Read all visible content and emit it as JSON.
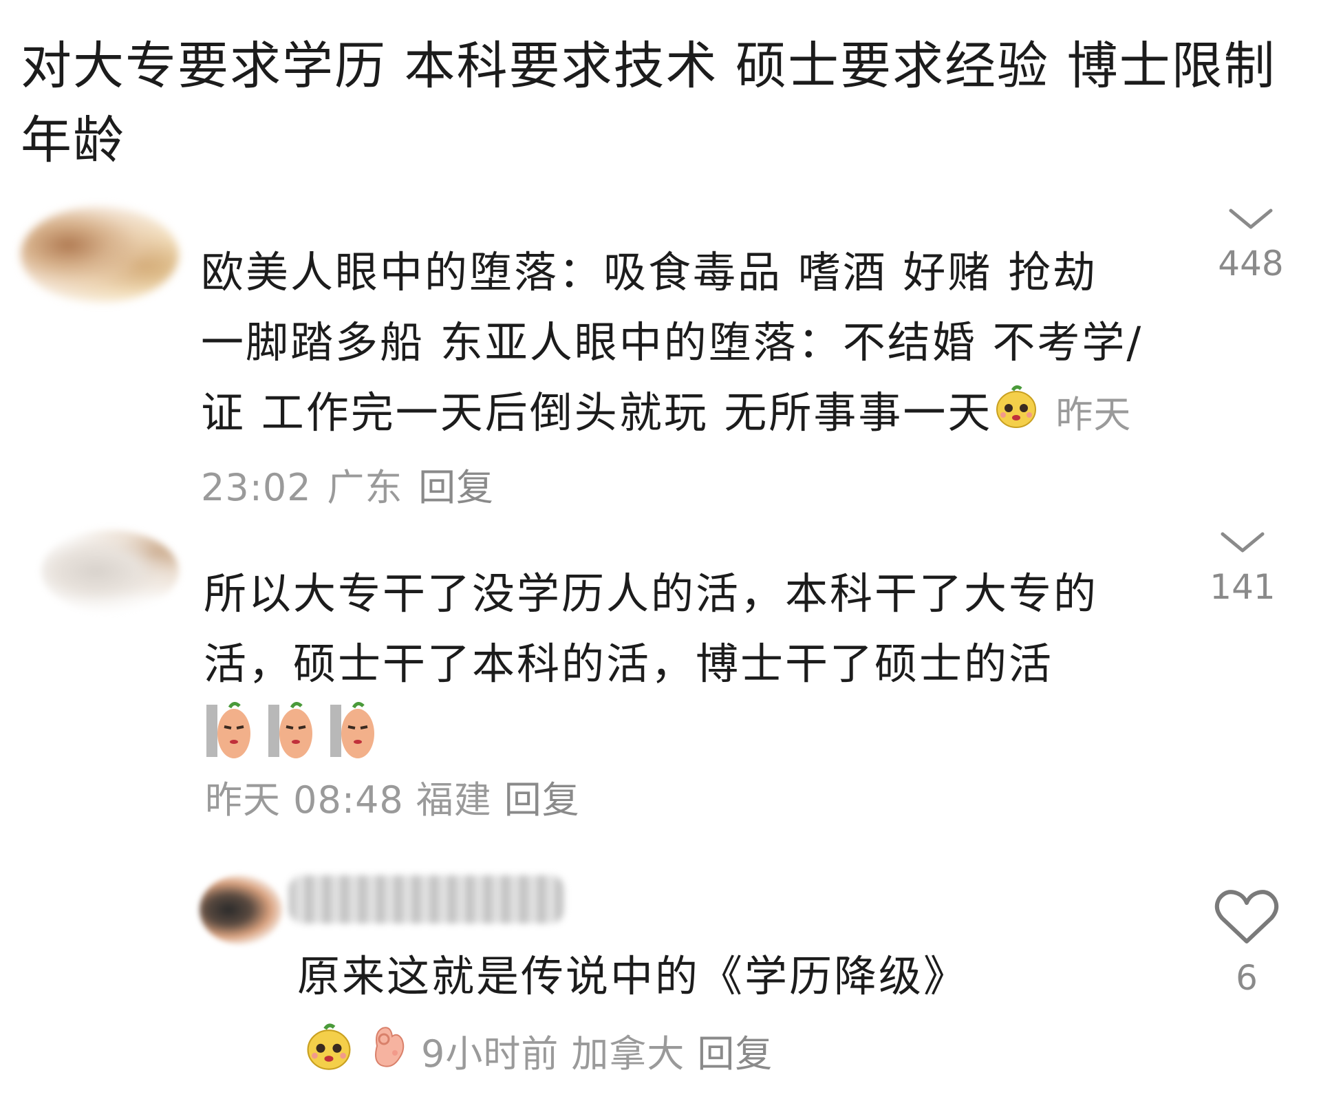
{
  "post": {
    "title": "对大专要求学历  本科要求技术  硕士要求经验 博士限制年龄"
  },
  "comments": [
    {
      "text": "欧美人眼中的堕落：吸食毒品 嗜酒 好赌 抢劫 一脚踏多船  东亚人眼中的堕落：不结婚 不考学/证  工作完一天后倒头就玩 无所事事一天",
      "emoji": "yellow-pear-face-emoji",
      "time": "昨天 23:02",
      "location": "广东",
      "reply_label": "回复",
      "likes": "448",
      "like_icon": "chevron-down-icon"
    },
    {
      "text": "所以大专干了没学历人的活，本科干了大专的活，硕士干了本科的活，博士干了硕士的活",
      "emoji": "peeking-wall-emoji",
      "time": "昨天 08:48",
      "location": "福建",
      "reply_label": "回复",
      "likes": "141",
      "like_icon": "chevron-down-icon"
    },
    {
      "text": "原来这就是传说中的《学历降级》",
      "emoji": [
        "yellow-pear-face-emoji",
        "ok-hand-emoji"
      ],
      "time": "9小时前",
      "location": "加拿大",
      "reply_label": "回复",
      "likes": "6",
      "like_icon": "heart-outline-icon"
    }
  ],
  "colors": {
    "text": "#1c1c1c",
    "meta": "#9a9a9a",
    "background": "#ffffff"
  }
}
